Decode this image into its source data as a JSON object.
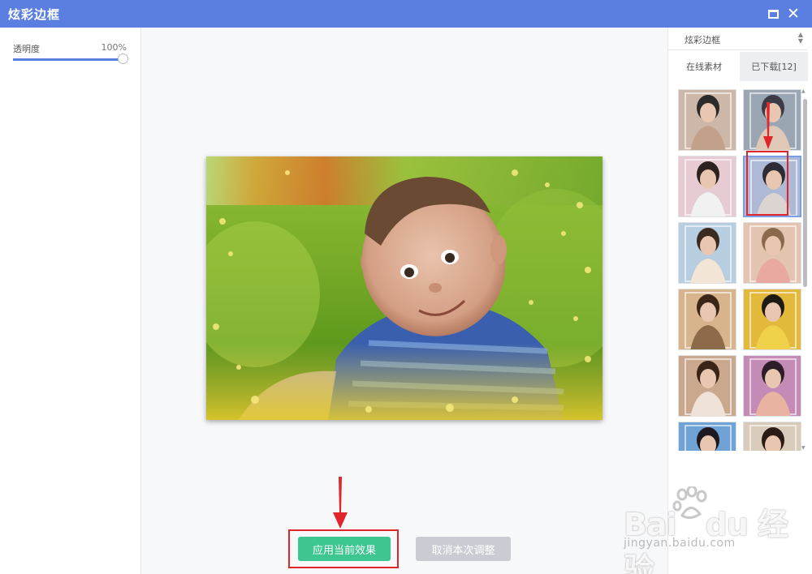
{
  "window": {
    "title": "炫彩边框"
  },
  "left_panel": {
    "opacity": {
      "label": "透明度",
      "value_text": "100%",
      "value_fraction": 1.0
    }
  },
  "actions": {
    "apply_label": "应用当前效果",
    "cancel_label": "取消本次调整"
  },
  "right_panel": {
    "category_select": "炫彩边框",
    "tabs": [
      {
        "label": "在线素材",
        "active": true
      },
      {
        "label": "已下载[12]",
        "active": false
      }
    ],
    "selected_thumbnail_index": 3,
    "thumbnail_count": 12
  },
  "colors": {
    "titlebar": "#5b7fe0",
    "apply": "#3ec691",
    "cancel": "#c9ccd2",
    "highlight": "#e0262b"
  },
  "watermark": {
    "brand": "Bai du 经验",
    "url": "jingyan.baidu.com"
  }
}
